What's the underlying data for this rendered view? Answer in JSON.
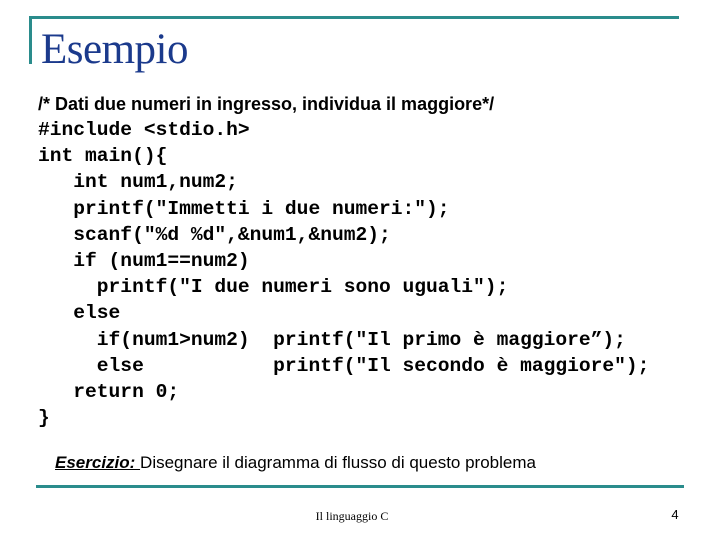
{
  "slide": {
    "title": "Esempio",
    "comment": "/* Dati due numeri in ingresso, individua il maggiore*/",
    "code_lines": [
      "#include <stdio.h>",
      "int main(){",
      "   int num1,num2;",
      "   printf(\"Immetti i due numeri:\");",
      "   scanf(\"%d %d\",&num1,&num2);",
      "   if (num1==num2)",
      "     printf(\"I due numeri sono uguali\");",
      "   else",
      "     if(num1>num2)  printf(\"Il primo è maggiore”);",
      "     else           printf(\"Il secondo è maggiore\");",
      "   return 0;",
      "}"
    ],
    "exercise": {
      "label": "Esercizio: ",
      "text": "Disegnare il diagramma di flusso di questo problema"
    }
  },
  "footer": {
    "title": "Il linguaggio C",
    "page_number": "4"
  },
  "colors": {
    "accent_rule": "#2a8c8c",
    "title_text": "#1b3a8c"
  }
}
